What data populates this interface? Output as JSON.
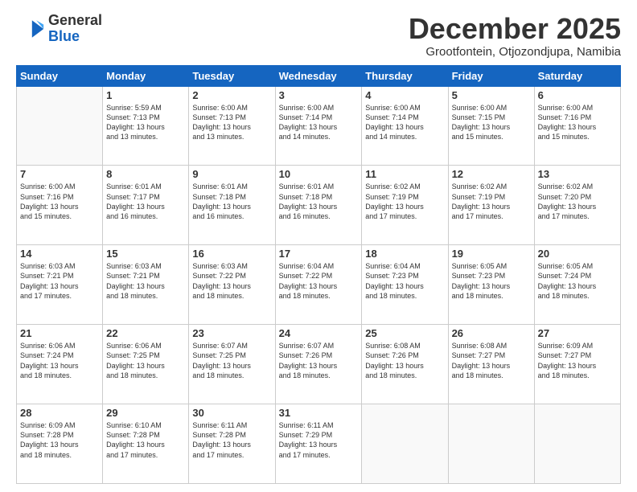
{
  "header": {
    "logo_line1": "General",
    "logo_line2": "Blue",
    "month_title": "December 2025",
    "subtitle": "Grootfontein, Otjozondjupa, Namibia"
  },
  "days_of_week": [
    "Sunday",
    "Monday",
    "Tuesday",
    "Wednesday",
    "Thursday",
    "Friday",
    "Saturday"
  ],
  "weeks": [
    [
      {
        "day": "",
        "info": ""
      },
      {
        "day": "1",
        "info": "Sunrise: 5:59 AM\nSunset: 7:13 PM\nDaylight: 13 hours\nand 13 minutes."
      },
      {
        "day": "2",
        "info": "Sunrise: 6:00 AM\nSunset: 7:13 PM\nDaylight: 13 hours\nand 13 minutes."
      },
      {
        "day": "3",
        "info": "Sunrise: 6:00 AM\nSunset: 7:14 PM\nDaylight: 13 hours\nand 14 minutes."
      },
      {
        "day": "4",
        "info": "Sunrise: 6:00 AM\nSunset: 7:14 PM\nDaylight: 13 hours\nand 14 minutes."
      },
      {
        "day": "5",
        "info": "Sunrise: 6:00 AM\nSunset: 7:15 PM\nDaylight: 13 hours\nand 15 minutes."
      },
      {
        "day": "6",
        "info": "Sunrise: 6:00 AM\nSunset: 7:16 PM\nDaylight: 13 hours\nand 15 minutes."
      }
    ],
    [
      {
        "day": "7",
        "info": "Sunrise: 6:00 AM\nSunset: 7:16 PM\nDaylight: 13 hours\nand 15 minutes."
      },
      {
        "day": "8",
        "info": "Sunrise: 6:01 AM\nSunset: 7:17 PM\nDaylight: 13 hours\nand 16 minutes."
      },
      {
        "day": "9",
        "info": "Sunrise: 6:01 AM\nSunset: 7:18 PM\nDaylight: 13 hours\nand 16 minutes."
      },
      {
        "day": "10",
        "info": "Sunrise: 6:01 AM\nSunset: 7:18 PM\nDaylight: 13 hours\nand 16 minutes."
      },
      {
        "day": "11",
        "info": "Sunrise: 6:02 AM\nSunset: 7:19 PM\nDaylight: 13 hours\nand 17 minutes."
      },
      {
        "day": "12",
        "info": "Sunrise: 6:02 AM\nSunset: 7:19 PM\nDaylight: 13 hours\nand 17 minutes."
      },
      {
        "day": "13",
        "info": "Sunrise: 6:02 AM\nSunset: 7:20 PM\nDaylight: 13 hours\nand 17 minutes."
      }
    ],
    [
      {
        "day": "14",
        "info": "Sunrise: 6:03 AM\nSunset: 7:21 PM\nDaylight: 13 hours\nand 17 minutes."
      },
      {
        "day": "15",
        "info": "Sunrise: 6:03 AM\nSunset: 7:21 PM\nDaylight: 13 hours\nand 18 minutes."
      },
      {
        "day": "16",
        "info": "Sunrise: 6:03 AM\nSunset: 7:22 PM\nDaylight: 13 hours\nand 18 minutes."
      },
      {
        "day": "17",
        "info": "Sunrise: 6:04 AM\nSunset: 7:22 PM\nDaylight: 13 hours\nand 18 minutes."
      },
      {
        "day": "18",
        "info": "Sunrise: 6:04 AM\nSunset: 7:23 PM\nDaylight: 13 hours\nand 18 minutes."
      },
      {
        "day": "19",
        "info": "Sunrise: 6:05 AM\nSunset: 7:23 PM\nDaylight: 13 hours\nand 18 minutes."
      },
      {
        "day": "20",
        "info": "Sunrise: 6:05 AM\nSunset: 7:24 PM\nDaylight: 13 hours\nand 18 minutes."
      }
    ],
    [
      {
        "day": "21",
        "info": "Sunrise: 6:06 AM\nSunset: 7:24 PM\nDaylight: 13 hours\nand 18 minutes."
      },
      {
        "day": "22",
        "info": "Sunrise: 6:06 AM\nSunset: 7:25 PM\nDaylight: 13 hours\nand 18 minutes."
      },
      {
        "day": "23",
        "info": "Sunrise: 6:07 AM\nSunset: 7:25 PM\nDaylight: 13 hours\nand 18 minutes."
      },
      {
        "day": "24",
        "info": "Sunrise: 6:07 AM\nSunset: 7:26 PM\nDaylight: 13 hours\nand 18 minutes."
      },
      {
        "day": "25",
        "info": "Sunrise: 6:08 AM\nSunset: 7:26 PM\nDaylight: 13 hours\nand 18 minutes."
      },
      {
        "day": "26",
        "info": "Sunrise: 6:08 AM\nSunset: 7:27 PM\nDaylight: 13 hours\nand 18 minutes."
      },
      {
        "day": "27",
        "info": "Sunrise: 6:09 AM\nSunset: 7:27 PM\nDaylight: 13 hours\nand 18 minutes."
      }
    ],
    [
      {
        "day": "28",
        "info": "Sunrise: 6:09 AM\nSunset: 7:28 PM\nDaylight: 13 hours\nand 18 minutes."
      },
      {
        "day": "29",
        "info": "Sunrise: 6:10 AM\nSunset: 7:28 PM\nDaylight: 13 hours\nand 17 minutes."
      },
      {
        "day": "30",
        "info": "Sunrise: 6:11 AM\nSunset: 7:28 PM\nDaylight: 13 hours\nand 17 minutes."
      },
      {
        "day": "31",
        "info": "Sunrise: 6:11 AM\nSunset: 7:29 PM\nDaylight: 13 hours\nand 17 minutes."
      },
      {
        "day": "",
        "info": ""
      },
      {
        "day": "",
        "info": ""
      },
      {
        "day": "",
        "info": ""
      }
    ]
  ]
}
